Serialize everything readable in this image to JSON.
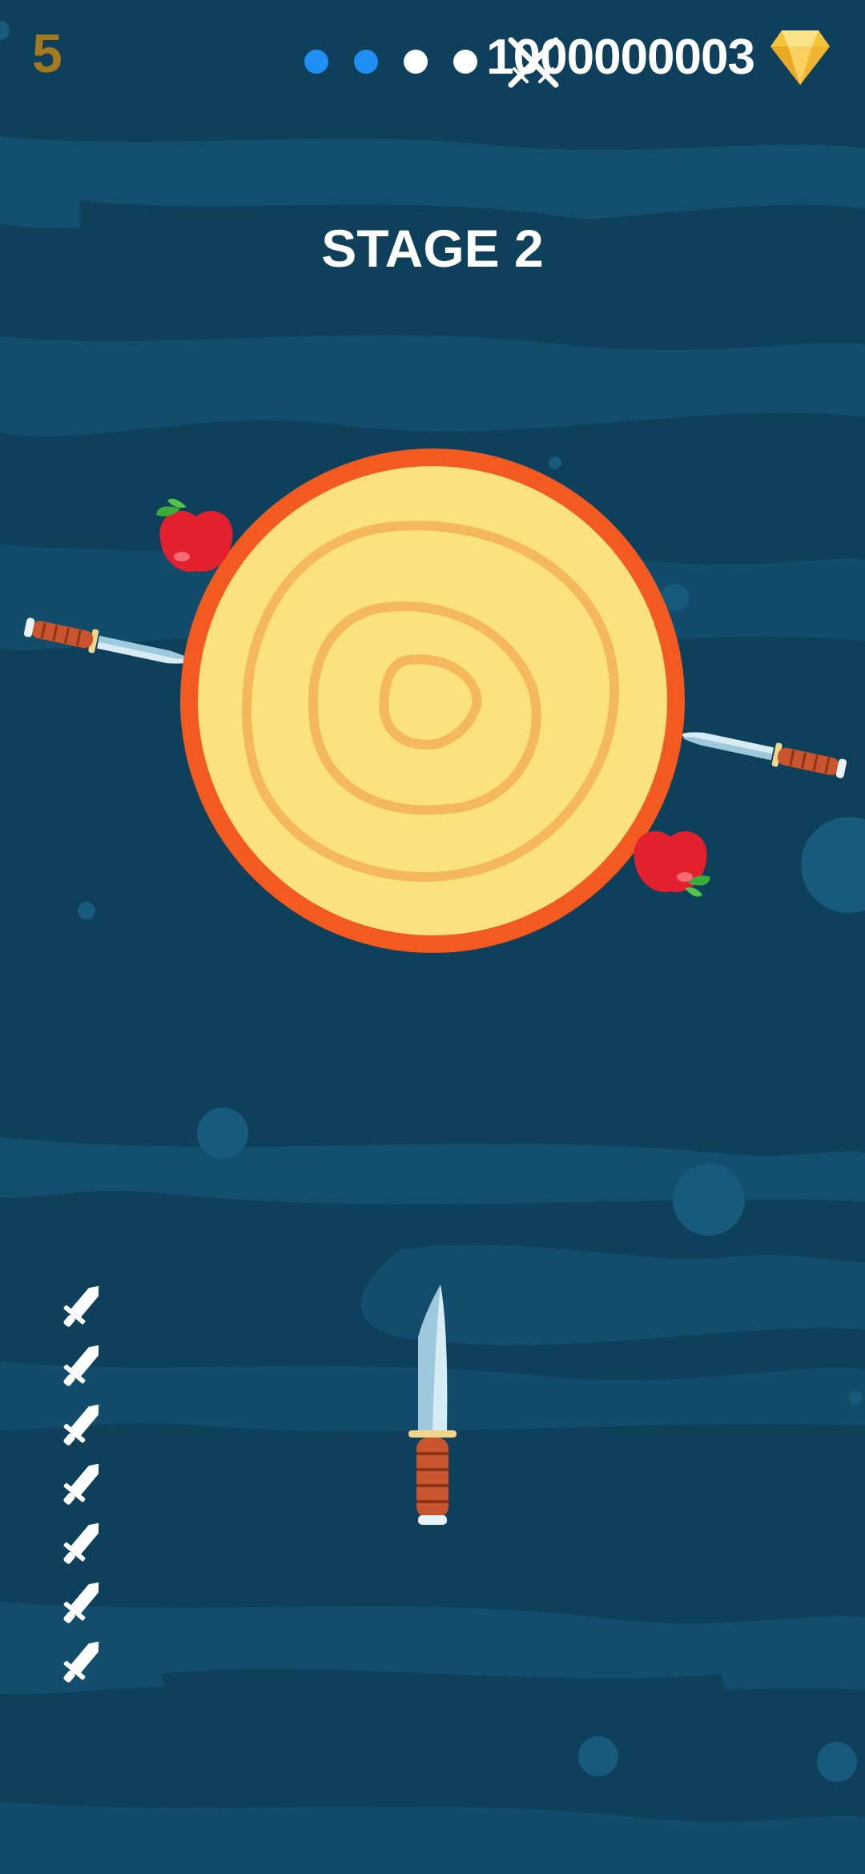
{
  "hud": {
    "score": "5",
    "stage_progress": {
      "total_stages": 4,
      "completed": 2,
      "completed_color": "#1f8ef5",
      "pending_color": "#ffffff"
    },
    "gem_count": "1000000003",
    "gem_icon": "diamond-icon",
    "gem_color": "#f5c43a"
  },
  "stage_label": "STAGE 2",
  "target": {
    "name": "wood-log-target",
    "stuck_knives": 2,
    "apples": 2,
    "rim_color": "#f25a1f",
    "face_color": "#fbe27d"
  },
  "knives_remaining": 7,
  "player_knife": "ready-knife",
  "colors": {
    "background": "#0e3f5b"
  }
}
